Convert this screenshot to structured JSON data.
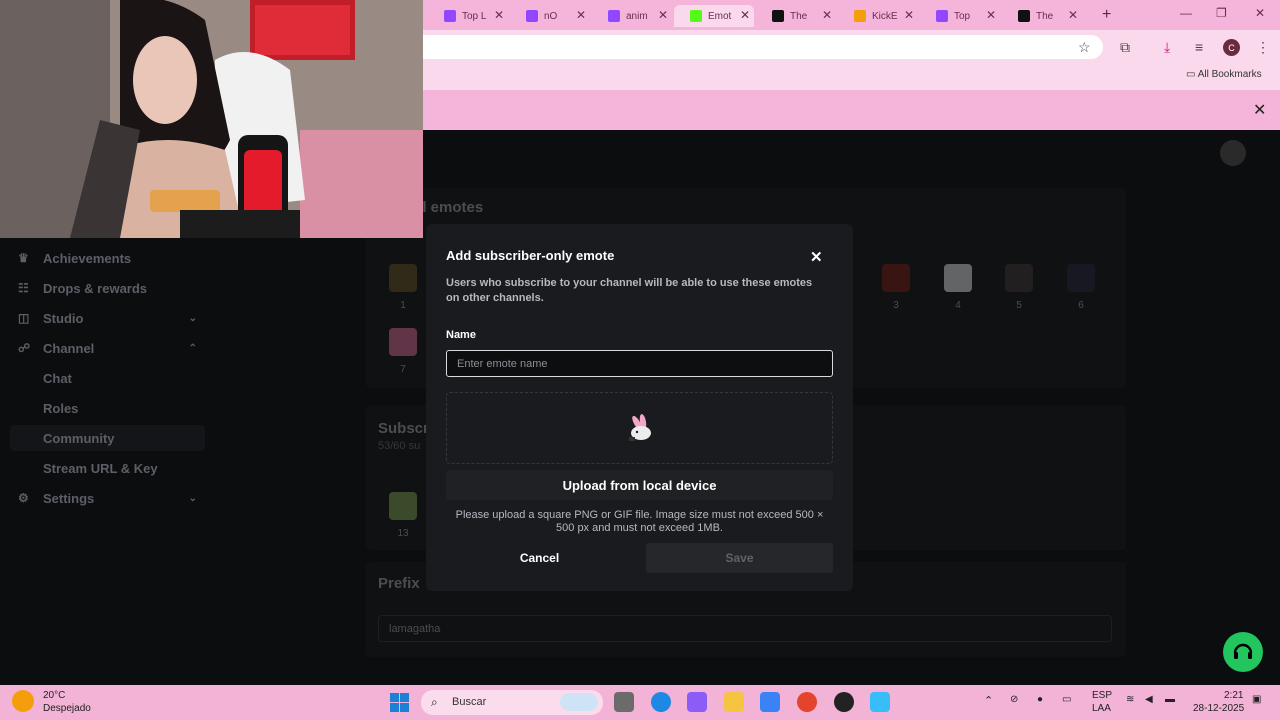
{
  "browser": {
    "tabs": [
      {
        "label": "Top L",
        "icon": "twitch-icon",
        "color": "#9146ff",
        "active": false
      },
      {
        "label": "nO",
        "icon": "twitch-icon",
        "color": "#9146ff",
        "active": false
      },
      {
        "label": "anim",
        "icon": "twitch-icon",
        "color": "#9146ff",
        "active": false
      },
      {
        "label": "Emot",
        "icon": "kick-icon",
        "color": "#53fc18",
        "active": true
      },
      {
        "label": "The",
        "icon": "site-icon",
        "color": "#111111",
        "active": false
      },
      {
        "label": "KickE",
        "icon": "kicke-icon",
        "color": "#f59e0b",
        "active": false
      },
      {
        "label": "Top",
        "icon": "twitch-icon",
        "color": "#9146ff",
        "active": false
      },
      {
        "label": "The",
        "icon": "site-icon",
        "color": "#111111",
        "active": false
      }
    ],
    "profile_initial": "C",
    "bookmarks_label": "All Bookmarks"
  },
  "sidebar": {
    "items": [
      {
        "label": "Achievements",
        "icon": "trophy-icon"
      },
      {
        "label": "Drops & rewards",
        "icon": "gift-icon"
      },
      {
        "label": "Studio",
        "icon": "studio-icon"
      },
      {
        "label": "Channel",
        "icon": "channel-icon"
      },
      {
        "label": "Chat"
      },
      {
        "label": "Roles"
      },
      {
        "label": "Community"
      },
      {
        "label": "Stream URL & Key"
      },
      {
        "label": "Settings",
        "icon": "gear-icon"
      }
    ]
  },
  "page": {
    "section_title": "el emotes",
    "emotes": [
      "1",
      "3",
      "4",
      "5",
      "6",
      "7"
    ],
    "subscriber_title": "Subscr",
    "subscriber_count": "53/60 su",
    "subscriber_emotes": [
      "13"
    ],
    "prefix_title": "Prefix",
    "prefix_value": "lamagatha"
  },
  "modal": {
    "title": "Add subscriber-only emote",
    "description": "Users who subscribe to your channel will be able to use these emotes on other channels.",
    "name_label": "Name",
    "name_placeholder": "Enter emote name",
    "name_value": "",
    "upload_label": "Upload from local device",
    "upload_hint": "Please upload a square PNG or GIF file. Image size must not exceed 500 × 500 px and must not exceed 1MB.",
    "cancel_label": "Cancel",
    "save_label": "Save"
  },
  "taskbar": {
    "weather_temp": "20°C",
    "weather_desc": "Despejado",
    "search_label": "Buscar",
    "lang_top": "ESP",
    "lang_bottom": "LAA",
    "time": "2:21",
    "date": "28-12-2025"
  },
  "colors": {
    "accent_green": "#22c55e",
    "chrome_pink": "#f5b4da",
    "modal_bg": "#191b1f"
  }
}
